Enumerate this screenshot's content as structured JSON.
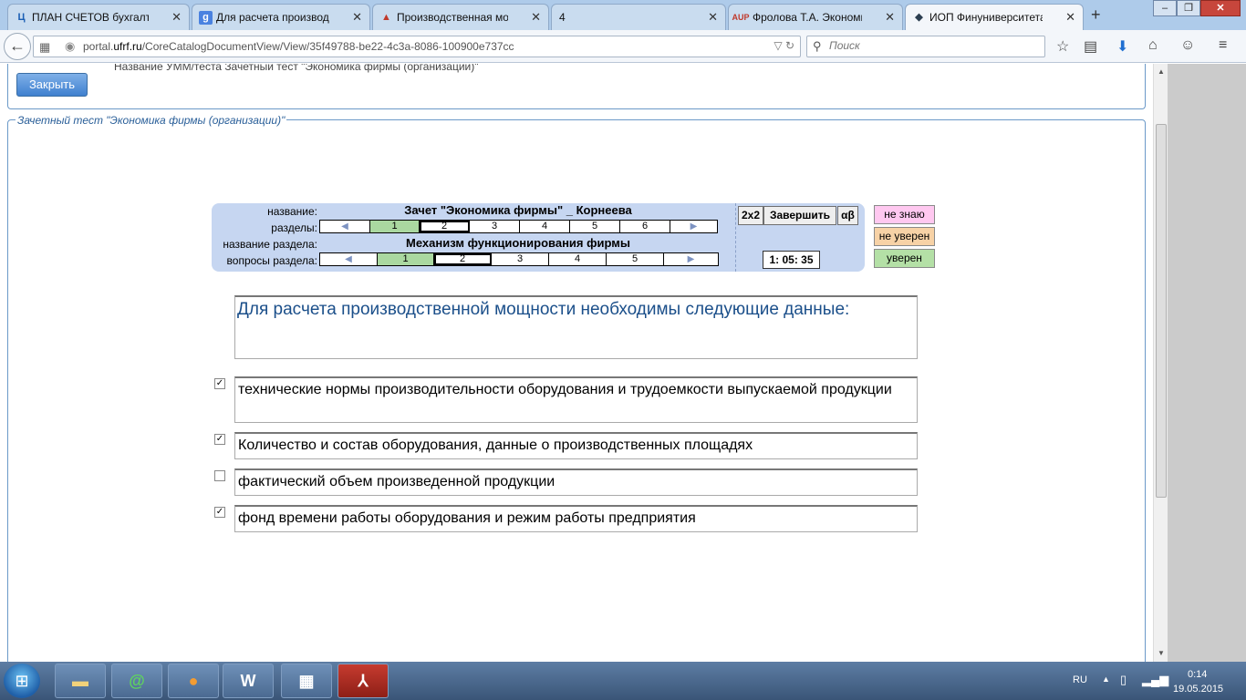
{
  "browser": {
    "tabs": [
      {
        "title": "ПЛАН СЧЕТОВ бухгалт...",
        "fav": "Ц",
        "fav_color": "#1a5fb4",
        "active": false
      },
      {
        "title": "Для расчета производс...",
        "fav": "g",
        "fav_color": "#4a82e0",
        "active": false
      },
      {
        "title": "Производственная мо...",
        "fav": "▲",
        "fav_color": "#c0392b",
        "active": false
      },
      {
        "title": "4",
        "fav": "",
        "fav_color": "#aaaaaa",
        "active": false
      },
      {
        "title": "Фролова Т.А. Экономи...",
        "fav": "AUP",
        "fav_color": "#c0392b",
        "active": false
      },
      {
        "title": "ИОП Финуниверситета...",
        "fav": "◆",
        "fav_color": "#2c3e50",
        "active": true
      }
    ],
    "url_prefix": "portal.",
    "url_domain": "ufrf.ru",
    "url_path": "/CoreCatalogDocumentView/View/35f49788-be22-4c3a-8086-100900e737cc",
    "search_placeholder": "Поиск"
  },
  "page": {
    "header_title": "Название УММ/теста  Зачетный тест \"Экономика фирмы (организации)\"",
    "close_button": "Закрыть",
    "panel_legend": "Зачетный тест \"Экономика фирмы (организации)\""
  },
  "widget": {
    "name_label": "название:",
    "name_value": "Зачет \"Экономика фирмы\" _ Корнеева",
    "sections_label": "разделы:",
    "sections": [
      "1",
      "2",
      "3",
      "4",
      "5",
      "6"
    ],
    "section_name_label": "название раздела:",
    "section_name_value": "Механизм функционирования  фирмы",
    "questions_label": "вопросы раздела:",
    "questions": [
      "1",
      "2",
      "3",
      "4",
      "5"
    ],
    "btn_2x2": "2x2",
    "btn_finish": "Завершить",
    "btn_ab": "αβ",
    "timer": "1: 05: 35",
    "conf_dont_know": "не знаю",
    "conf_not_sure": "не уверен",
    "conf_sure": "уверен",
    "colors": {
      "dont_know": "#ffc8f0",
      "not_sure": "#f7d2a6",
      "sure": "#b4e0a6"
    }
  },
  "question": {
    "text": "Для расчета производственной мощности необходимы следующие данные:",
    "answers": [
      {
        "text": "технические нормы производительности оборудования и трудоемкости выпускаемой продукции",
        "checked": true
      },
      {
        "text": "Количество и состав оборудования, данные о производственных площадях",
        "checked": true
      },
      {
        "text": "фактический объем  произведенной продукции",
        "checked": false
      },
      {
        "text": "фонд времени работы оборудования и  режим работы предприятия",
        "checked": true
      }
    ]
  },
  "taskbar": {
    "lang": "RU",
    "time": "0:14",
    "date": "19.05.2015",
    "apps": [
      "explorer-icon",
      "mail-icon",
      "firefox-icon",
      "word-icon",
      "calculator-icon",
      "acrobat-icon"
    ]
  }
}
